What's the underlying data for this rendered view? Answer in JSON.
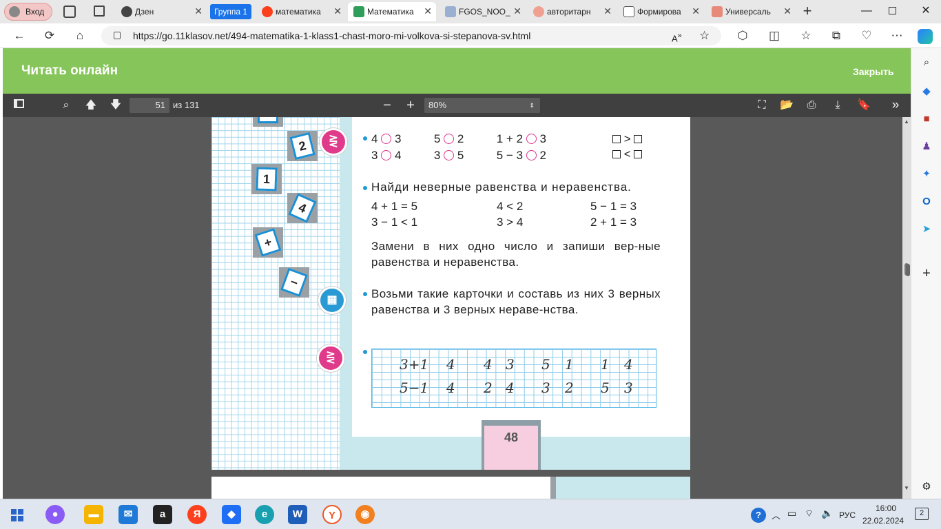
{
  "browser": {
    "profile_label": "Вход",
    "tabs": [
      {
        "label": "Дзен"
      },
      {
        "label": "Группа 1"
      },
      {
        "label": "математика"
      },
      {
        "label": "Математика"
      },
      {
        "label": "FGOS_NOO_"
      },
      {
        "label": "авторитарн"
      },
      {
        "label": "Формирова"
      },
      {
        "label": "Универсаль"
      }
    ],
    "url": "https://go.11klasov.net/494-matematika-1-klass1-chast-moro-mi-volkova-si-stepanova-sv.html"
  },
  "site": {
    "title": "Читать онлайн",
    "close_label": "Закрыть"
  },
  "viewer": {
    "page_current": "51",
    "page_total": "из 131",
    "zoom": "80%"
  },
  "book": {
    "cards": [
      "2",
      "1",
      "4",
      "+",
      "−"
    ],
    "compare_row1": [
      "4",
      "3",
      "5",
      "2",
      "1 + 2",
      "3"
    ],
    "compare_row2": [
      "3",
      "4",
      "3",
      "5",
      "5 − 3",
      "2"
    ],
    "ineq_gt": ">",
    "ineq_lt": "<",
    "task2_title": "Найди неверные равенства и неравенства.",
    "task2_eqs": [
      "4 + 1 = 5",
      "4 < 2",
      "5 − 1 = 3",
      "3 − 1 < 1",
      "3 > 4",
      "2 + 1 = 3"
    ],
    "task2_text": "Замени в них одно число и запиши вер-ные равенства и неравенства.",
    "task3_text": "Возьми такие карточки и составь из них 3 верных равенства и 3 верных нераве-нства.",
    "handwriting_row1": [
      "3+1",
      "4",
      "4",
      "3",
      "5",
      "1",
      "1",
      "4"
    ],
    "handwriting_row2": [
      "5−1",
      "4",
      "2",
      "4",
      "3",
      "2",
      "5",
      "3"
    ],
    "page_number": "48"
  },
  "taskbar": {
    "lang": "РУС",
    "time": "16:00",
    "date": "22.02.2024",
    "notif_count": "2"
  },
  "colors": {
    "site_green": "#86c55a",
    "viewer_dark": "#404040",
    "accent_blue": "#1b9ad6",
    "pink": "#e0338f"
  }
}
